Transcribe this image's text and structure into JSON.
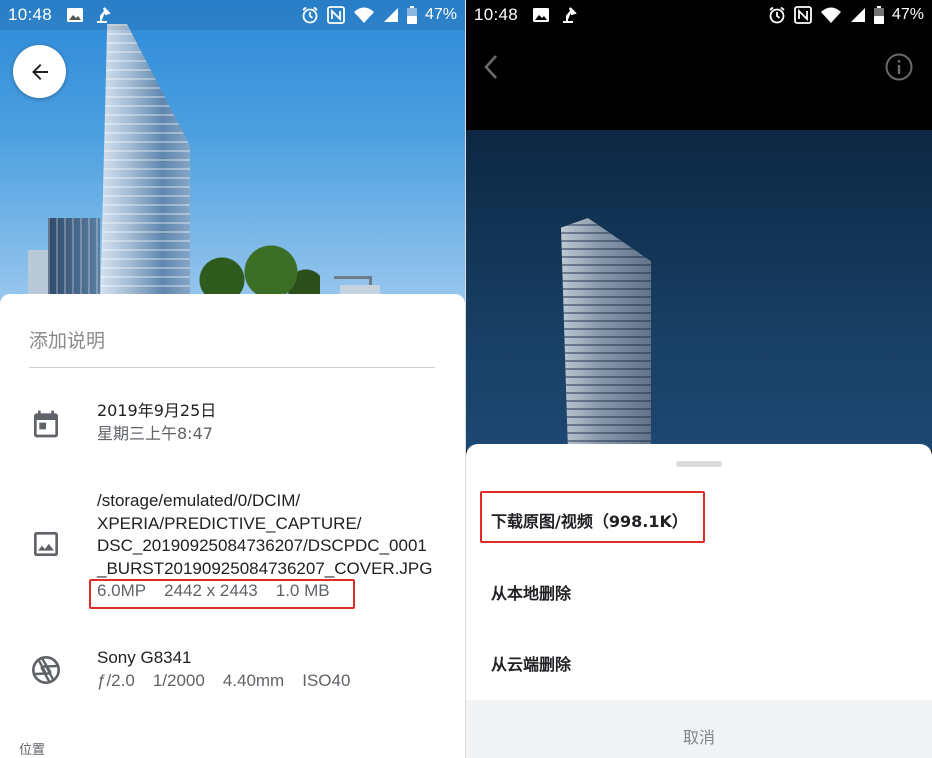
{
  "left_screen": {
    "status_bar": {
      "time": "10:48",
      "battery_percent": "47%",
      "icons": [
        "image-icon",
        "lamp-icon",
        "alarm-icon",
        "nfc-icon",
        "wifi-icon",
        "signal-icon",
        "battery-icon"
      ]
    },
    "details": {
      "caption_placeholder": "添加说明",
      "date": {
        "line1": "2019年9月25日",
        "line2": "星期三上午8:47",
        "icon": "calendar-icon"
      },
      "file": {
        "path_lines": [
          "/storage/emulated/0/DCIM/",
          "XPERIA/PREDICTIVE_CAPTURE/",
          "DSC_20190925084736207/DSCPDC_0001",
          "_BURST20190925084736207_COVER.JPG"
        ],
        "megapixels": "6.0MP",
        "dimensions": "2442 x 2443",
        "size": "1.0 MB",
        "icon": "image-icon"
      },
      "camera": {
        "model": "Sony G8341",
        "aperture": "ƒ/2.0",
        "shutter": "1/2000",
        "focal_length": "4.40mm",
        "iso": "ISO40",
        "icon": "aperture-icon"
      },
      "location_label": "位置"
    }
  },
  "right_screen": {
    "status_bar": {
      "time": "10:48",
      "battery_percent": "47%"
    },
    "actions": [
      {
        "label": "下载原图/视频（998.1K）"
      },
      {
        "label": "从本地删除"
      },
      {
        "label": "从云端删除"
      }
    ],
    "cancel_label": "取消"
  },
  "colors": {
    "highlight": "#e02b2b",
    "sky": "#4ea1e0",
    "dark_sky": "#183e62"
  }
}
